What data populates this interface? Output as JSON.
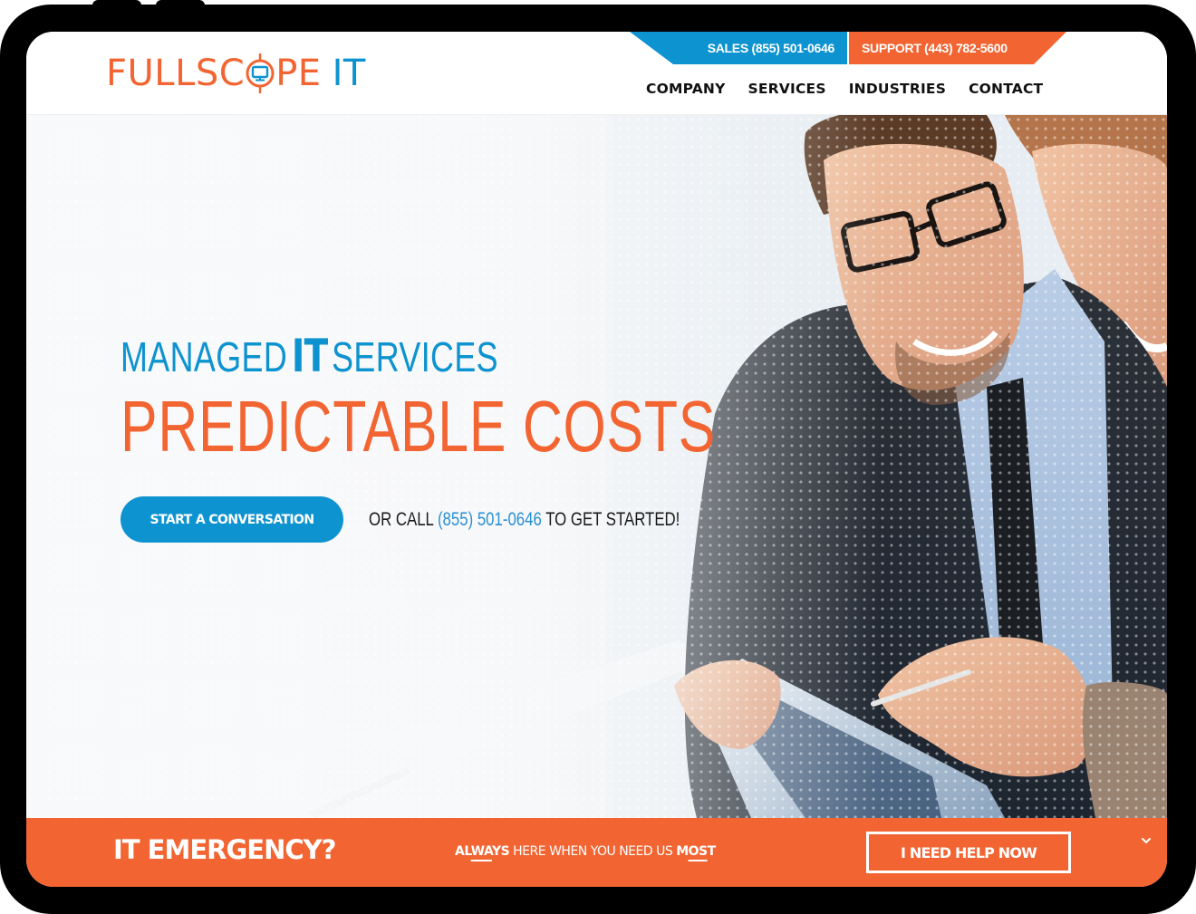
{
  "header": {
    "logo": {
      "part1": "FULLSC",
      "part2": "PE",
      "part3": "IT",
      "icon": "target-monitor-icon"
    },
    "topbar": {
      "sales": "SALES (855) 501-0646",
      "support": "SUPPORT (443) 782-5600"
    },
    "nav": [
      {
        "label": "COMPANY"
      },
      {
        "label": "SERVICES"
      },
      {
        "label": "INDUSTRIES"
      },
      {
        "label": "CONTACT"
      }
    ]
  },
  "hero": {
    "line1_a": "MANAGED",
    "line1_b": "IT",
    "line1_c": "SERVICES",
    "line2": "PREDICTABLE COSTS",
    "cta_label": "START A CONVERSATION",
    "call_prefix": "OR CALL",
    "call_phone": "(855) 501-0646",
    "call_suffix": "TO GET STARTED!",
    "image_alt": "businessman with glasses and colleague smiling at a tablet"
  },
  "emergency": {
    "title": "IT EMERGENCY?",
    "tag_always_1": "AL",
    "tag_always_2": "WA",
    "tag_always_3": "YS",
    "tag_middle": "HERE WHEN YOU NEED US",
    "tag_most_1": "M",
    "tag_most_2": "OS",
    "tag_most_3": "T",
    "button": "I NEED HELP NOW",
    "chevron": "chevron-down-icon"
  },
  "colors": {
    "brand_orange": "#f26532",
    "brand_blue": "#0d93cf",
    "nav_text": "#111111",
    "link_blue": "#2b8fd6"
  }
}
